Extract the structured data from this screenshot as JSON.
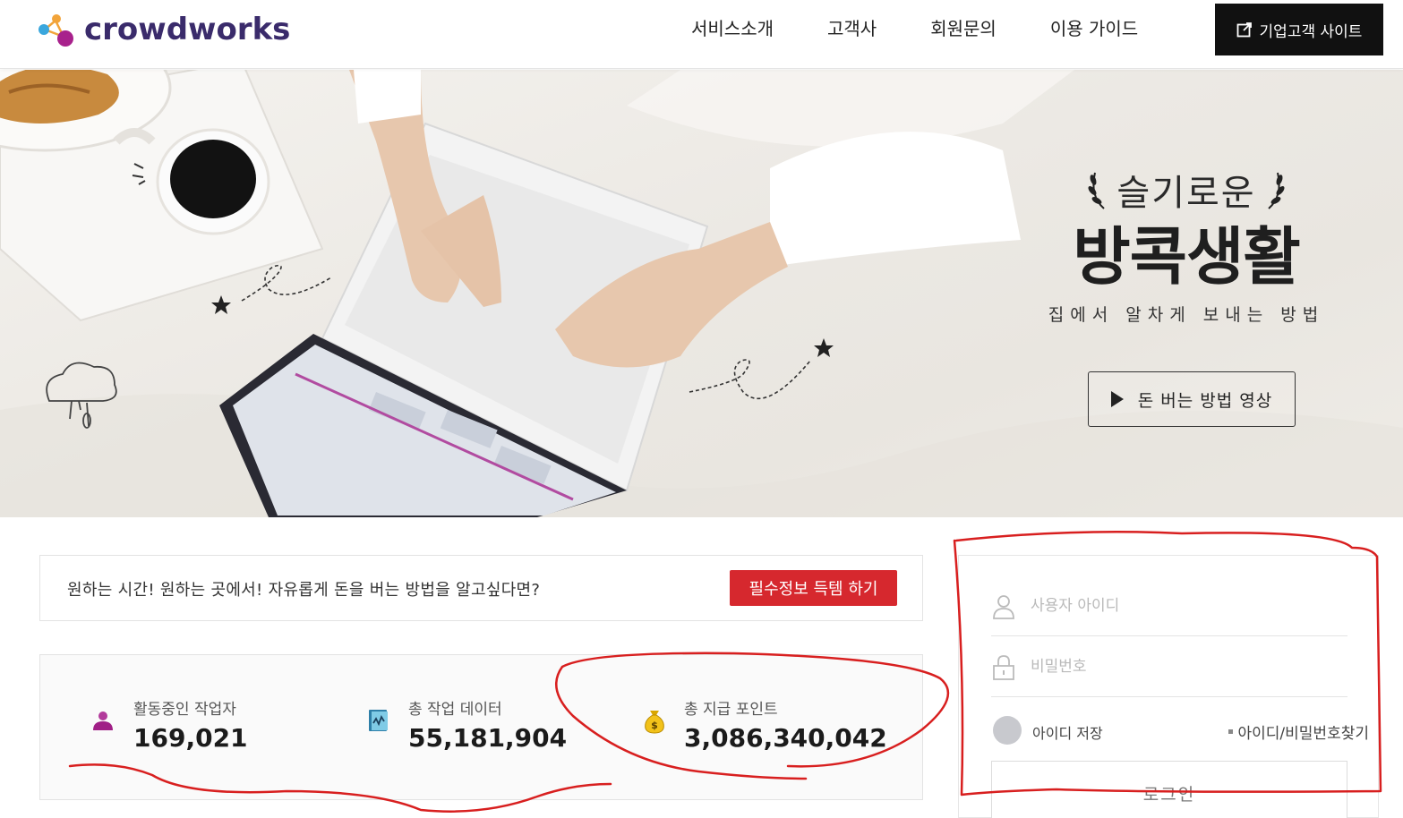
{
  "header": {
    "logo_text": "crowdworks",
    "nav": [
      "서비스소개",
      "고객사",
      "회원문의",
      "이용 가이드"
    ],
    "corp_button": "기업고객 사이트"
  },
  "hero": {
    "sub1": "슬기로운",
    "title": "방콕생활",
    "sub2": "집에서 알차게 보내는 방법",
    "video_button": "돈 버는 방법 영상"
  },
  "info": {
    "text": "원하는 시간! 원하는 곳에서! 자유롭게 돈을 버는 방법을 알고싶다면?",
    "button": "필수정보 득템 하기"
  },
  "stats": [
    {
      "icon": "worker-icon",
      "label": "활동중인 작업자",
      "value": "169,021"
    },
    {
      "icon": "data-book-icon",
      "label": "총 작업 데이터",
      "value": "55,181,904"
    },
    {
      "icon": "money-bag-icon",
      "label": "총 지급 포인트",
      "value": "3,086,340,042"
    }
  ],
  "login": {
    "id_placeholder": "사용자 아이디",
    "pw_placeholder": "비밀번호",
    "save_label": "아이디 저장",
    "find_link": "아이디/비밀번호찾기",
    "login_button": "로그인"
  },
  "colors": {
    "brand_purple": "#3a2b6b",
    "accent_red": "#d6282e",
    "annotation_red": "#d81f1f",
    "header_button_bg": "#111111"
  }
}
